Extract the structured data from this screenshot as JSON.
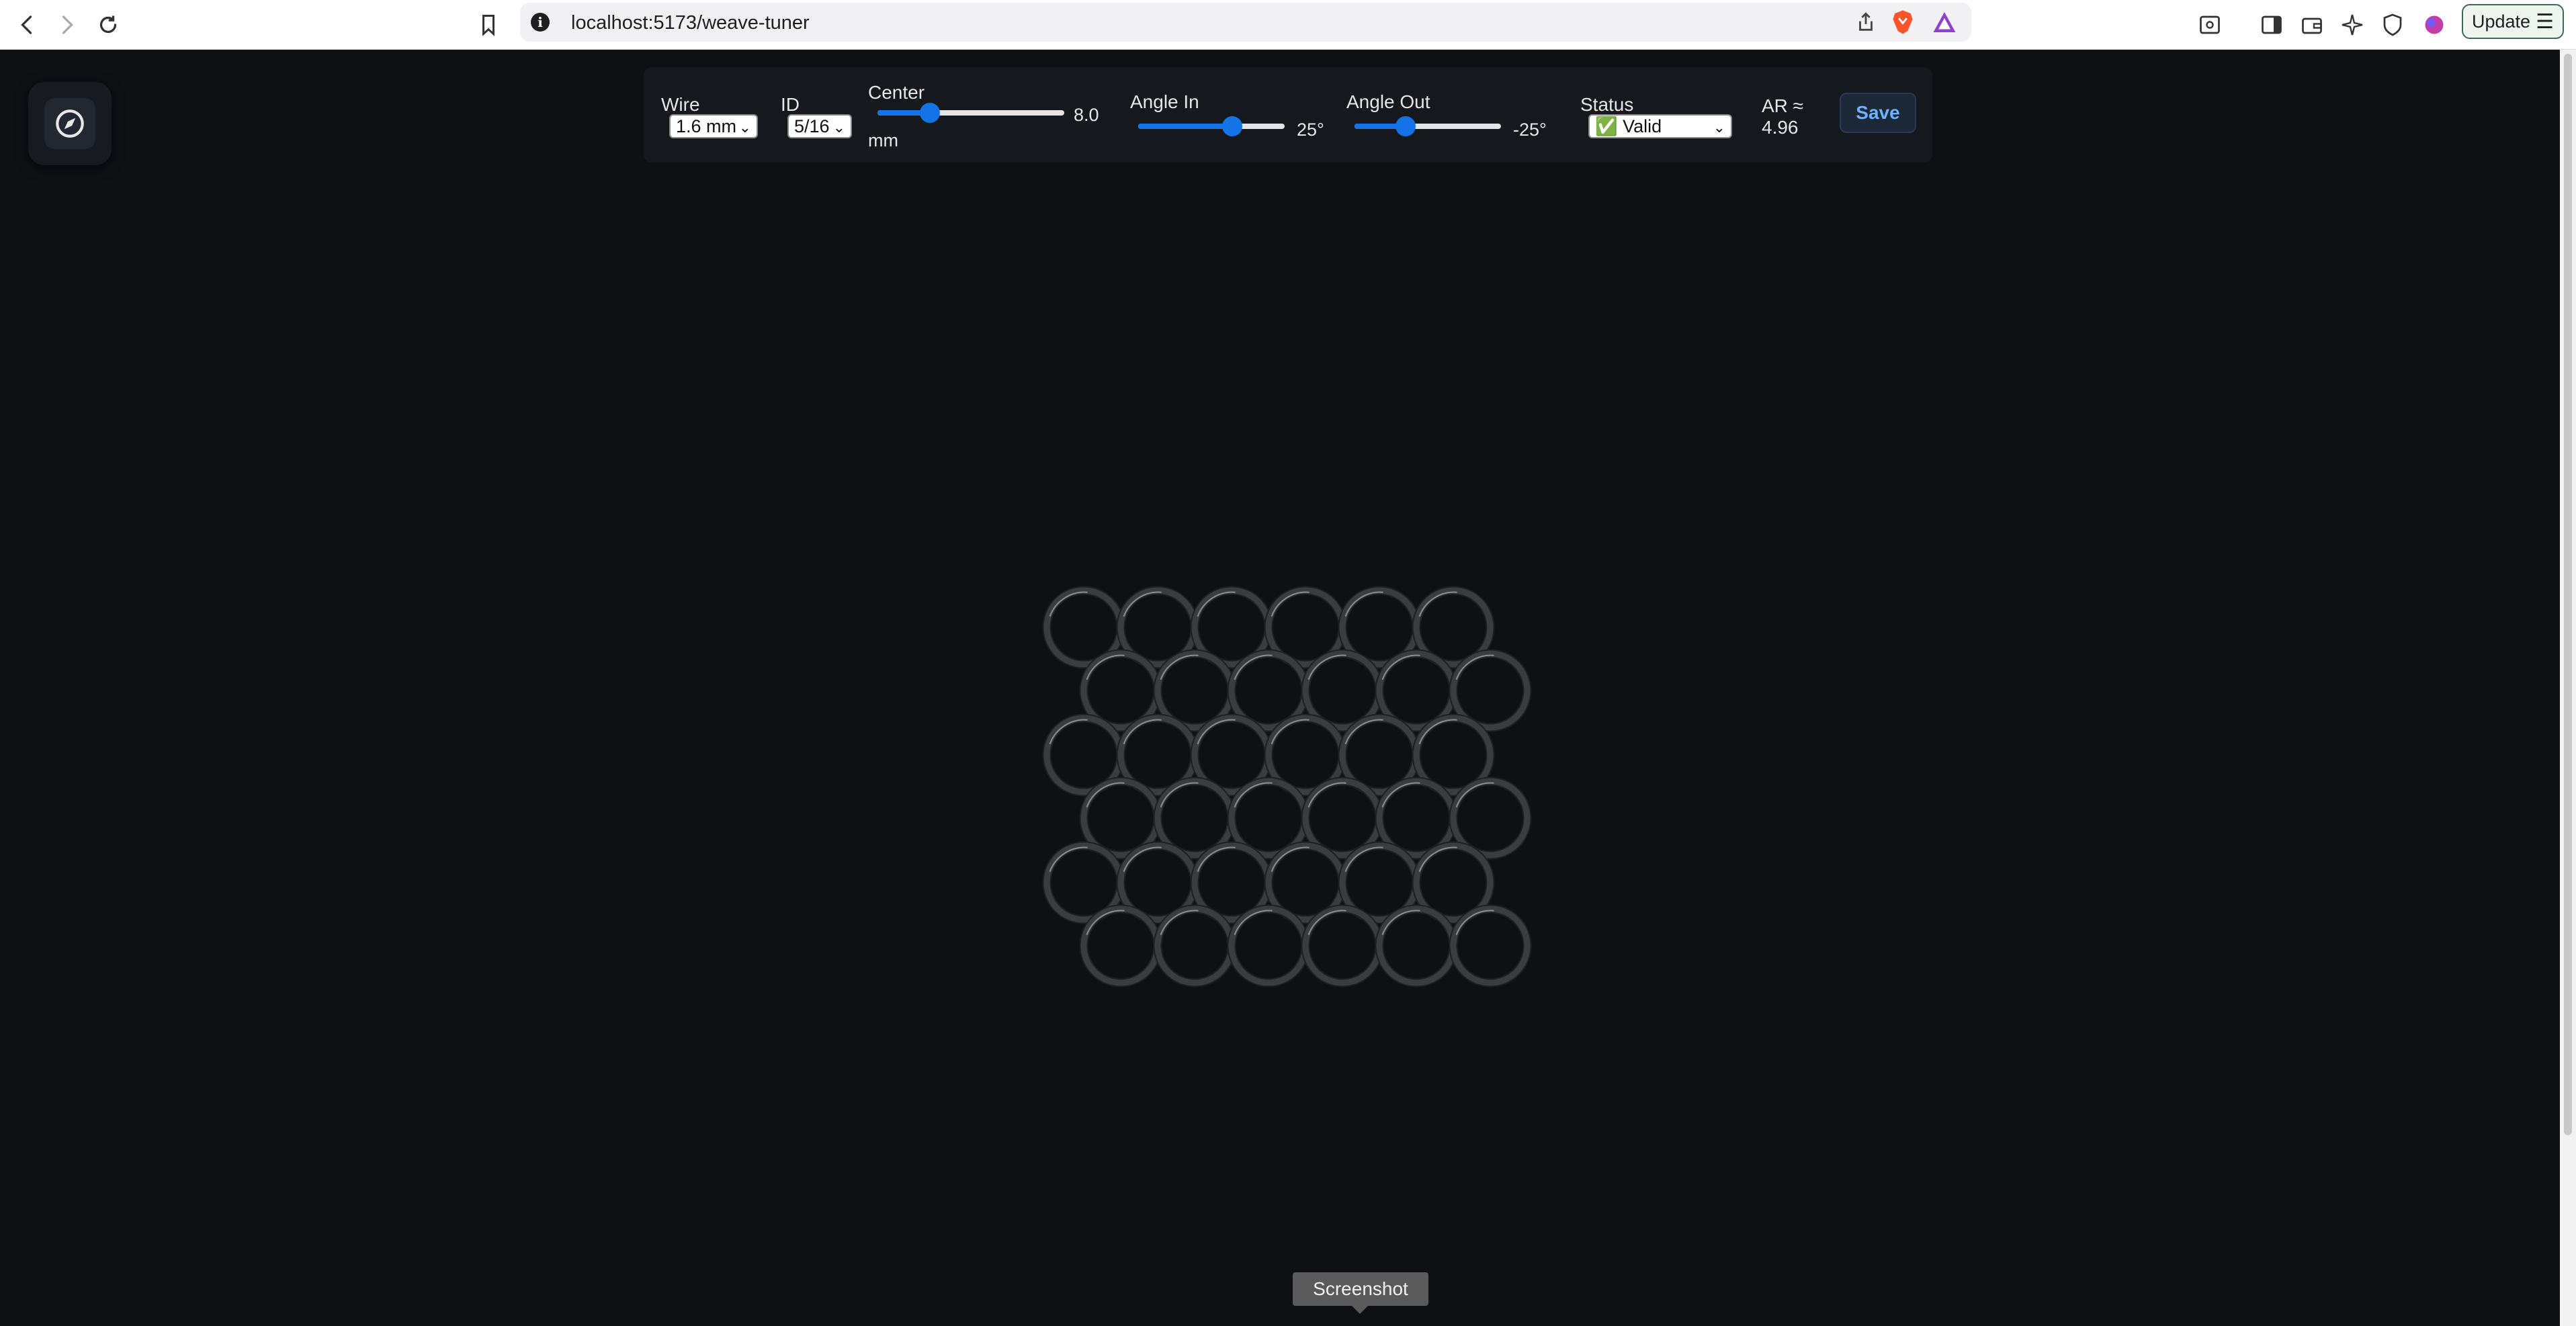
{
  "browser": {
    "url": "localhost:5173/weave-tuner",
    "update_label": "Update"
  },
  "toolbar": {
    "wire": {
      "label": "Wire",
      "value": "1.6 mm"
    },
    "id": {
      "label": "ID",
      "value": "5/16"
    },
    "center": {
      "label": "Center",
      "value": "8.0",
      "unit": "mm",
      "level": 0.28
    },
    "angle_in": {
      "label": "Angle In",
      "value": "25°",
      "level": 0.64
    },
    "angle_out": {
      "label": "Angle Out",
      "value": "-25°",
      "level": 0.35
    },
    "status": {
      "label": "Status",
      "value": "✅ Valid"
    },
    "ar": {
      "label": "AR ≈",
      "value": "4.96"
    },
    "save_label": "Save"
  },
  "weave": {
    "rows": 3,
    "rings_per_row": 6,
    "ring_color": "#3a3c40"
  },
  "tooltip": "Screenshot",
  "colors": {
    "background": "#0e1013",
    "toolbar": "#15181d",
    "accent": "#1473e6",
    "save_text": "#6fb0ff"
  }
}
